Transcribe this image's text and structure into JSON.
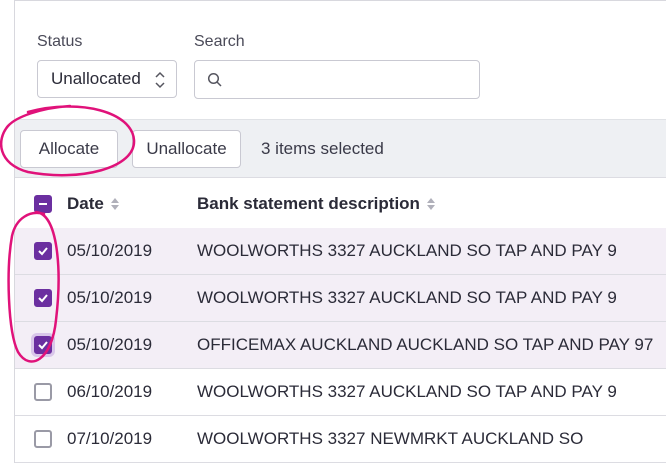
{
  "filters": {
    "status_label": "Status",
    "status_value": "Unallocated",
    "search_label": "Search",
    "search_value": "",
    "search_placeholder": ""
  },
  "toolbar": {
    "allocate_label": "Allocate",
    "unallocate_label": "Unallocate",
    "selection_text": "3 items selected"
  },
  "table": {
    "columns": [
      "Date",
      "Bank statement description"
    ],
    "rows": [
      {
        "date": "05/10/2019",
        "description": "WOOLWORTHS 3327 AUCKLAND SO TAP AND PAY 9",
        "selected": true
      },
      {
        "date": "05/10/2019",
        "description": "WOOLWORTHS 3327 AUCKLAND SO TAP AND PAY 9",
        "selected": true
      },
      {
        "date": "05/10/2019",
        "description": "OFFICEMAX AUCKLAND AUCKLAND SO TAP AND PAY 97",
        "selected": true
      },
      {
        "date": "06/10/2019",
        "description": "WOOLWORTHS 3327 AUCKLAND SO TAP AND PAY 9",
        "selected": false
      },
      {
        "date": "07/10/2019",
        "description": "WOOLWORTHS 3327 NEWMRKT AUCKLAND SO",
        "selected": false
      }
    ]
  },
  "colors": {
    "accent": "#6b2fa0",
    "annotation": "#e0127a",
    "selected_row": "#f3eef6",
    "toolbar_bg": "#eef0f3"
  },
  "icons": {
    "search": "search-icon",
    "select_chevron": "chevron-up-down-icon",
    "sort": "sort-icon",
    "checkbox": "checkbox-icon"
  }
}
